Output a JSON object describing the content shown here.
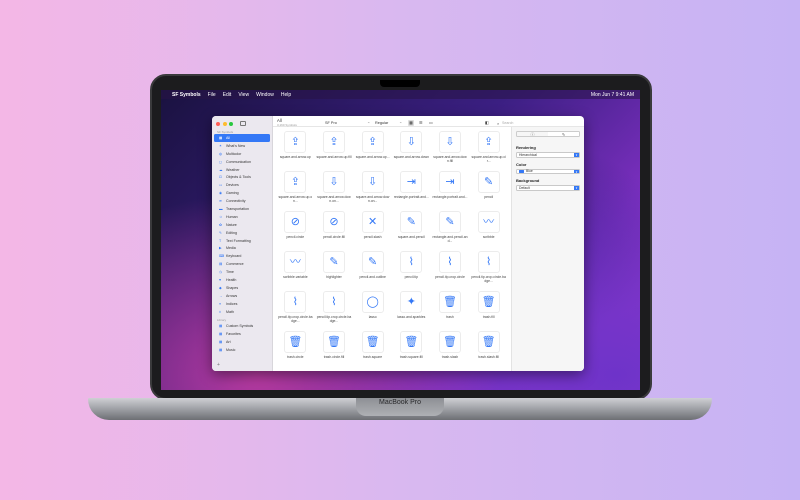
{
  "menubar": {
    "apple": "",
    "app": "SF Symbols",
    "items": [
      "File",
      "Edit",
      "View",
      "Window",
      "Help"
    ],
    "clock": "Mon Jun 7  9:41 AM"
  },
  "laptop": {
    "label": "MacBook Pro"
  },
  "window": {
    "title": "All",
    "subtitle": "3,160 Symbols",
    "font": "SF Pro",
    "weight": "Regular",
    "search_icon": "magnifier-icon",
    "search_placeholder": "Search"
  },
  "sidebar": {
    "header": "SF Symbols",
    "items": [
      {
        "icon": "▦",
        "label": "All",
        "active": true
      },
      {
        "icon": "✶",
        "label": "What's New"
      },
      {
        "icon": "◍",
        "label": "Multicolor"
      },
      {
        "icon": "◻",
        "label": "Communication"
      },
      {
        "icon": "☁",
        "label": "Weather"
      },
      {
        "icon": "⊡",
        "label": "Objects & Tools"
      },
      {
        "icon": "▭",
        "label": "Devices"
      },
      {
        "icon": "◉",
        "label": "Gaming"
      },
      {
        "icon": "≋",
        "label": "Connectivity"
      },
      {
        "icon": "▬",
        "label": "Transportation"
      },
      {
        "icon": "☺",
        "label": "Human"
      },
      {
        "icon": "✿",
        "label": "Nature"
      },
      {
        "icon": "✎",
        "label": "Editing"
      },
      {
        "icon": "T",
        "label": "Text Formatting"
      },
      {
        "icon": "▶",
        "label": "Media"
      },
      {
        "icon": "⌨",
        "label": "Keyboard"
      },
      {
        "icon": "▤",
        "label": "Commerce"
      },
      {
        "icon": "◷",
        "label": "Time"
      },
      {
        "icon": "♥",
        "label": "Health"
      },
      {
        "icon": "◆",
        "label": "Shapes"
      },
      {
        "icon": "→",
        "label": "Arrows"
      },
      {
        "icon": "≡",
        "label": "Indices"
      },
      {
        "icon": "±",
        "label": "Math"
      }
    ],
    "library_header": "Library",
    "library": [
      {
        "icon": "▦",
        "label": "Custom Symbols"
      },
      {
        "icon": "▦",
        "label": "Favorites"
      },
      {
        "icon": "▦",
        "label": "Art"
      },
      {
        "icon": "▦",
        "label": "Music"
      }
    ],
    "add": "+"
  },
  "symbols": [
    {
      "glyph": "⇪",
      "label": "square.and.arrow.up"
    },
    {
      "glyph": "⇪",
      "label": "square.and.arrow.up.fill"
    },
    {
      "glyph": "⇪",
      "label": "square.and.arrow.up..."
    },
    {
      "glyph": "⇩",
      "label": "square.and.arrow.down"
    },
    {
      "glyph": "⇩",
      "label": "square.and.arrow.down.fill"
    },
    {
      "glyph": "⇪",
      "label": "square.and.arrow.up.cir..."
    },
    {
      "glyph": "⇪",
      "label": "square.and.arrow.up.on..."
    },
    {
      "glyph": "⇩",
      "label": "square.and.arrow.down.on..."
    },
    {
      "glyph": "⇩",
      "label": "square.and.arrow.down.on..."
    },
    {
      "glyph": "⇥",
      "label": "rectangle.portrait.and..."
    },
    {
      "glyph": "⇥",
      "label": "rectangle.portrait.and..."
    },
    {
      "glyph": "✎",
      "label": "pencil"
    },
    {
      "glyph": "⊘",
      "label": "pencil.circle"
    },
    {
      "glyph": "⊘",
      "label": "pencil.circle.fill"
    },
    {
      "glyph": "✕",
      "label": "pencil.slash"
    },
    {
      "glyph": "✎",
      "label": "square.and.pencil"
    },
    {
      "glyph": "✎",
      "label": "rectangle.and.pencil.and..."
    },
    {
      "glyph": "〰",
      "label": "scribble"
    },
    {
      "glyph": "〰",
      "label": "scribble.variable"
    },
    {
      "glyph": "✎",
      "label": "highlighter"
    },
    {
      "glyph": "✎",
      "label": "pencil.and.outline"
    },
    {
      "glyph": "⌇",
      "label": "pencil.tip"
    },
    {
      "glyph": "⌇",
      "label": "pencil.tip.crop.circle"
    },
    {
      "glyph": "⌇",
      "label": "pencil.tip.crop.circle.badge..."
    },
    {
      "glyph": "⌇",
      "label": "pencil.tip.crop.circle.badge..."
    },
    {
      "glyph": "⌇",
      "label": "pencil.tip.crop.circle.badge..."
    },
    {
      "glyph": "◯",
      "label": "lasso"
    },
    {
      "glyph": "✦",
      "label": "lasso.and.sparkles"
    },
    {
      "glyph": "🗑",
      "label": "trash"
    },
    {
      "glyph": "🗑",
      "label": "trash.fill"
    },
    {
      "glyph": "🗑",
      "label": "trash.circle"
    },
    {
      "glyph": "🗑",
      "label": "trash.circle.fill"
    },
    {
      "glyph": "🗑",
      "label": "trash.square"
    },
    {
      "glyph": "🗑",
      "label": "trash.square.fill"
    },
    {
      "glyph": "🗑",
      "label": "trash.slash"
    },
    {
      "glyph": "🗑",
      "label": "trash.slash.fill"
    }
  ],
  "inspector": {
    "tab_info": "ⓘ",
    "tab_paint": "✎",
    "rendering_label": "Rendering",
    "rendering_value": "Hierarchical",
    "color_label": "Color",
    "color_value": "Blue",
    "background_label": "Background",
    "background_value": "Default",
    "accent": "#3478f6"
  }
}
